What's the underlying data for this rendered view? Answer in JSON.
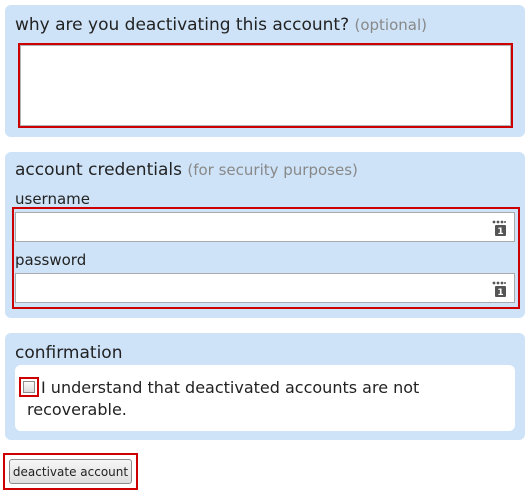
{
  "reason_section": {
    "title": "why are you deactivating this account?",
    "note": "(optional)",
    "textarea_value": ""
  },
  "credentials_section": {
    "title": "account credentials",
    "note": "(for security purposes)",
    "username_label": "username",
    "username_value": "",
    "password_label": "password",
    "password_value": "",
    "field_icon": "password-manager-icon"
  },
  "confirmation_section": {
    "title": "confirmation",
    "checkbox_checked": false,
    "checkbox_label": "I understand that deactivated accounts are not recoverable."
  },
  "submit": {
    "label": "deactivate account"
  },
  "colors": {
    "panel_bg": "#cee3f8",
    "highlight_border": "#cc0000",
    "muted_text": "#888888"
  }
}
